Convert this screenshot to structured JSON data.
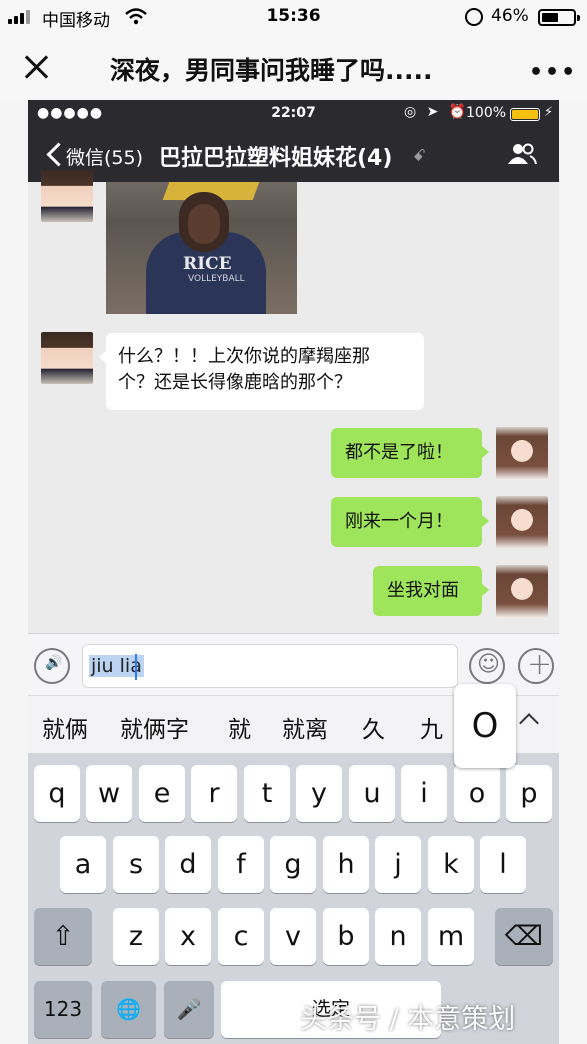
{
  "outer_status": {
    "carrier": "中国移动",
    "time": "15:36",
    "battery_pct": "46%"
  },
  "outer_nav": {
    "title": "深夜，男同事问我睡了吗.....",
    "more": "•••"
  },
  "inner_status": {
    "dots": "●●●●●",
    "time": "22:07",
    "icons": "◎ ➤ ⏰",
    "battery_pct": "100%",
    "bolt": "⚡"
  },
  "inner_nav": {
    "back_label": "微信(55)",
    "chat_title": "巴拉巴拉塑料姐妹花(4)",
    "mute_icon": "ꗃ"
  },
  "photo": {
    "shirt_text": "RICE",
    "shirt_sub": "VOLLEYBALL"
  },
  "messages": [
    {
      "side": "left",
      "text_line1": "什么？！！上次你说的摩羯座那",
      "text_line2": "个？还是长得像鹿晗的那个？"
    },
    {
      "side": "right",
      "text": "都不是了啦！"
    },
    {
      "side": "right",
      "text": "刚来一个月！"
    },
    {
      "side": "right",
      "text": "坐我对面"
    }
  ],
  "input": {
    "value": "jiu lia",
    "voice_icon": "🔊",
    "emoji_icon": "☺",
    "plus_icon": "+"
  },
  "candidates": [
    "就俩",
    "就俩字",
    "就",
    "就离",
    "久",
    "九"
  ],
  "keyboard": {
    "row1": [
      "q",
      "w",
      "e",
      "r",
      "t",
      "y",
      "u",
      "i",
      "o",
      "p"
    ],
    "row2": [
      "a",
      "s",
      "d",
      "f",
      "g",
      "h",
      "j",
      "k",
      "l"
    ],
    "row3": [
      "z",
      "x",
      "c",
      "v",
      "b",
      "n",
      "m"
    ],
    "popup": "O",
    "shift": "⇧",
    "delete": "⌫",
    "numbers": "123",
    "globe": "🌐",
    "mic": "🎤",
    "space": "选定"
  },
  "watermark": "头条号 / 本意策划"
}
